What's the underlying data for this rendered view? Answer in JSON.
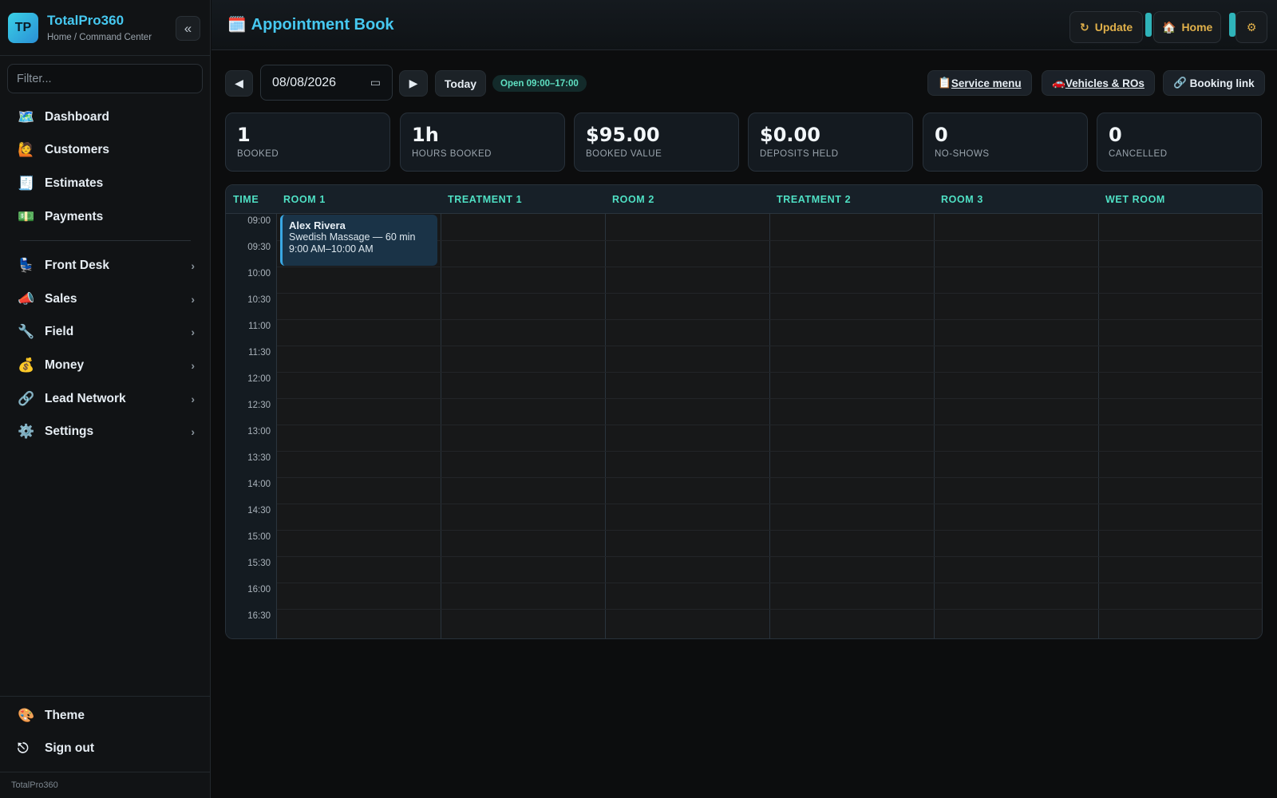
{
  "app": {
    "logo_text": "TP",
    "name": "TotalPro360",
    "breadcrumb": "Home / Command Center",
    "collapse_glyph": "«",
    "footer": "TotalPro360"
  },
  "sidebar": {
    "filter_placeholder": "Filter...",
    "items": [
      {
        "label": "Dashboard",
        "icon": "🗺️"
      },
      {
        "label": "Customers",
        "icon": "🙋"
      },
      {
        "label": "Estimates",
        "icon": "🧾"
      },
      {
        "label": "Payments",
        "icon": "💵"
      }
    ],
    "groups": [
      {
        "label": "Front Desk",
        "icon": "💺"
      },
      {
        "label": "Sales",
        "icon": "📣"
      },
      {
        "label": "Field",
        "icon": "🔧"
      },
      {
        "label": "Money",
        "icon": "💰"
      },
      {
        "label": "Lead Network",
        "icon": "🔗"
      },
      {
        "label": "Settings",
        "icon": "⚙️"
      }
    ],
    "bottom": [
      {
        "label": "Theme",
        "icon": "🎨"
      },
      {
        "label": "Sign out",
        "icon": "⎋"
      }
    ],
    "chevron": "›"
  },
  "header": {
    "title": "Appointment Book",
    "title_icon": "🗓️",
    "update_label": "Update",
    "update_icon": "↻",
    "home_label": "Home",
    "home_icon": "🏠",
    "settings_icon": "⚙"
  },
  "toolbar": {
    "prev_glyph": "◀",
    "next_glyph": "▶",
    "date_value": "08/08/2026",
    "today_label": "Today",
    "open_hours": "Open 09:00–17:00",
    "service_menu": "Service menu",
    "service_menu_icon": "📋",
    "vehicles": "Vehicles & ROs",
    "vehicles_icon": "🚗",
    "booking_link": "Booking link",
    "booking_link_icon": "🔗"
  },
  "stats": [
    {
      "value": "1",
      "label": "BOOKED"
    },
    {
      "value": "1h",
      "label": "HOURS BOOKED"
    },
    {
      "value": "$95.00",
      "label": "BOOKED VALUE"
    },
    {
      "value": "$0.00",
      "label": "DEPOSITS HELD"
    },
    {
      "value": "0",
      "label": "NO-SHOWS"
    },
    {
      "value": "0",
      "label": "CANCELLED"
    }
  ],
  "schedule": {
    "time_header": "TIME",
    "columns": [
      "ROOM 1",
      "TREATMENT 1",
      "ROOM 2",
      "TREATMENT 2",
      "ROOM 3",
      "WET ROOM"
    ],
    "times": [
      "09:00",
      "09:30",
      "10:00",
      "10:30",
      "11:00",
      "11:30",
      "12:00",
      "12:30",
      "13:00",
      "13:30",
      "14:00",
      "14:30",
      "15:00",
      "15:30",
      "16:00",
      "16:30"
    ],
    "appointment": {
      "client": "Alex Rivera",
      "service": "Swedish Massage — 60 min",
      "time": "9:00 AM–10:00 AM",
      "column": "ROOM 1"
    }
  },
  "colors": {
    "accent": "#46c8f0",
    "teal": "#4fe0c4",
    "warning": "#e0b04a",
    "appt_bg": "#1a3347"
  }
}
